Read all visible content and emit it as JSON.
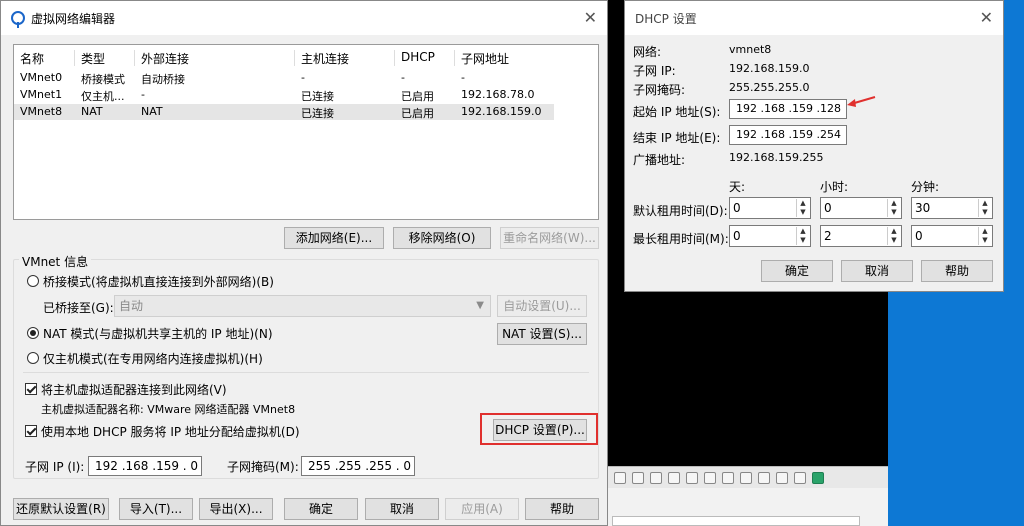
{
  "main_dialog": {
    "title": "虚拟网络编辑器",
    "close_glyph": "✕",
    "table": {
      "headers": [
        "名称",
        "类型",
        "外部连接",
        "主机连接",
        "DHCP",
        "子网地址"
      ],
      "rows": [
        [
          "VMnet0",
          "桥接模式",
          "自动桥接",
          "-",
          "-",
          "-"
        ],
        [
          "VMnet1",
          "仅主机...",
          "-",
          "已连接",
          "已启用",
          "192.168.78.0"
        ],
        [
          "VMnet8",
          "NAT",
          "NAT",
          "已连接",
          "已启用",
          "192.168.159.0"
        ]
      ],
      "selected_row": 2
    },
    "list_buttons": {
      "add": "添加网络(E)...",
      "remove": "移除网络(O)",
      "rename": "重命名网络(W)..."
    },
    "vmnet_info": {
      "group_title": "VMnet 信息",
      "bridged_radio": "桥接模式(将虚拟机直接连接到外部网络)(B)",
      "bridged_to_label": "已桥接至(G):",
      "bridged_to_value": "自动",
      "auto_settings": "自动设置(U)...",
      "nat_radio": "NAT 模式(与虚拟机共享主机的 IP 地址)(N)",
      "nat_settings": "NAT 设置(S)...",
      "host_only_radio": "仅主机模式(在专用网络内连接虚拟机)(H)",
      "connect_adapter_check": "将主机虚拟适配器连接到此网络(V)",
      "adapter_name": "主机虚拟适配器名称: VMware 网络适配器 VMnet8",
      "use_dhcp_check": "使用本地 DHCP 服务将 IP 地址分配给虚拟机(D)",
      "dhcp_settings": "DHCP 设置(P)...",
      "subnet_ip_label": "子网 IP (I):",
      "subnet_ip": "192 .168 .159 .  0",
      "subnet_mask_label": "子网掩码(M):",
      "subnet_mask": "255 .255 .255 .  0",
      "selected_mode": "nat",
      "connect_adapter_checked": true,
      "use_dhcp_checked": true
    },
    "bottom_buttons": {
      "restore": "还原默认设置(R)",
      "import": "导入(T)...",
      "export": "导出(X)...",
      "ok": "确定",
      "cancel": "取消",
      "apply": "应用(A)",
      "help": "帮助"
    }
  },
  "dhcp_dialog": {
    "title": "DHCP 设置",
    "close_glyph": "✕",
    "network_label": "网络:",
    "network_value": "vmnet8",
    "subnet_ip_label": "子网 IP:",
    "subnet_ip_value": "192.168.159.0",
    "subnet_mask_label": "子网掩码:",
    "subnet_mask_value": "255.255.255.0",
    "start_ip_label": "起始 IP 地址(S):",
    "start_ip_value": "192 .168 .159 .128",
    "end_ip_label": "结束 IP 地址(E):",
    "end_ip_value": "192 .168 .159 .254",
    "broadcast_label": "广播地址:",
    "broadcast_value": "192.168.159.255",
    "col_days": "天:",
    "col_hours": "小时:",
    "col_minutes": "分钟:",
    "default_lease_label": "默认租用时间(D):",
    "default_lease": [
      "0",
      "0",
      "30"
    ],
    "max_lease_label": "最长租用时间(M):",
    "max_lease": [
      "0",
      "2",
      "0"
    ],
    "ok": "确定",
    "cancel": "取消",
    "help": "帮助"
  },
  "colors": {
    "highlight_box": "#e0302e",
    "desktop_blue": "#0d78d4"
  }
}
